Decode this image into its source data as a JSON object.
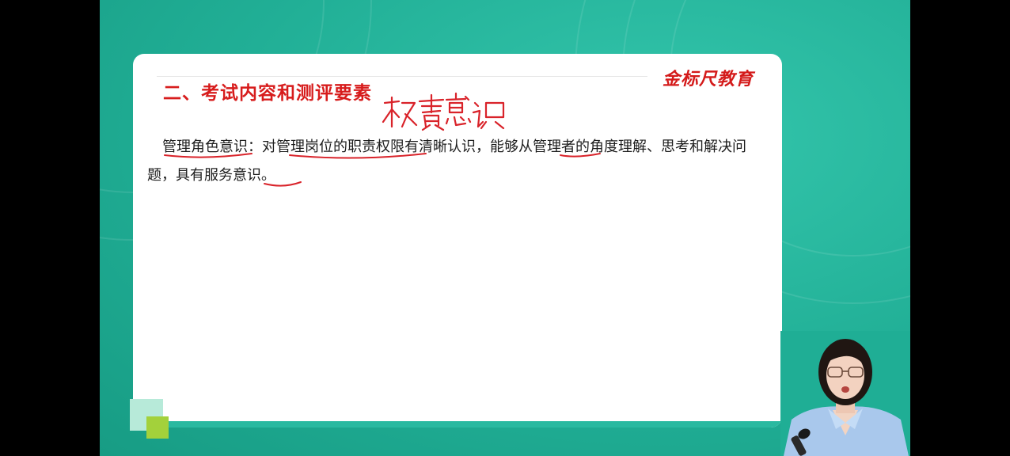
{
  "slide": {
    "title": "二、考试内容和测评要素",
    "brand": "金标尺教育",
    "body": "管理角色意识：对管理岗位的职责权限有清晰认识，能够从管理者的角度理解、思考和解决问题，具有服务意识。",
    "handwritten_note": "权责意识"
  },
  "colors": {
    "background_teal": "#21af96",
    "title_red": "#d71c1c",
    "brand_red": "#d41a1a",
    "annotation_red": "#d9232a",
    "accent_green": "#a3d13b",
    "accent_mint": "#b7ead9"
  }
}
